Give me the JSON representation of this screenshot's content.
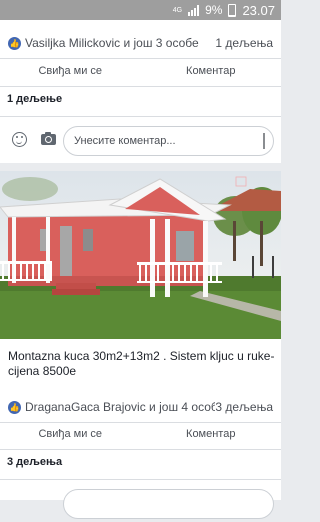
{
  "status_bar": {
    "network": "4G",
    "battery": "9%",
    "time": "23.07"
  },
  "post1": {
    "reactions": {
      "names": "Vasiljka Milickovic и још 3 особе",
      "shares": "1 дељења"
    },
    "actions": {
      "like": "Свиђа ми се",
      "comment": "Коментар"
    },
    "shares_count": "1 дељење",
    "comment_placeholder": "Унесите коментар..."
  },
  "post2": {
    "text": "Montazna kuca 30m2+13m2 . Sistem kljuc u ruke-cijena 8500e",
    "reactions": {
      "names": "DraganaGaca Brajovic и још 4 особе",
      "shares": "3 дељења"
    },
    "actions": {
      "like": "Свиђа ми се",
      "comment": "Коментар"
    },
    "shares_count": "3 дељења"
  },
  "colors": {
    "facebook_blue": "#4267b2",
    "house_wall": "#d9605c",
    "grass": "#4f7a2e"
  }
}
